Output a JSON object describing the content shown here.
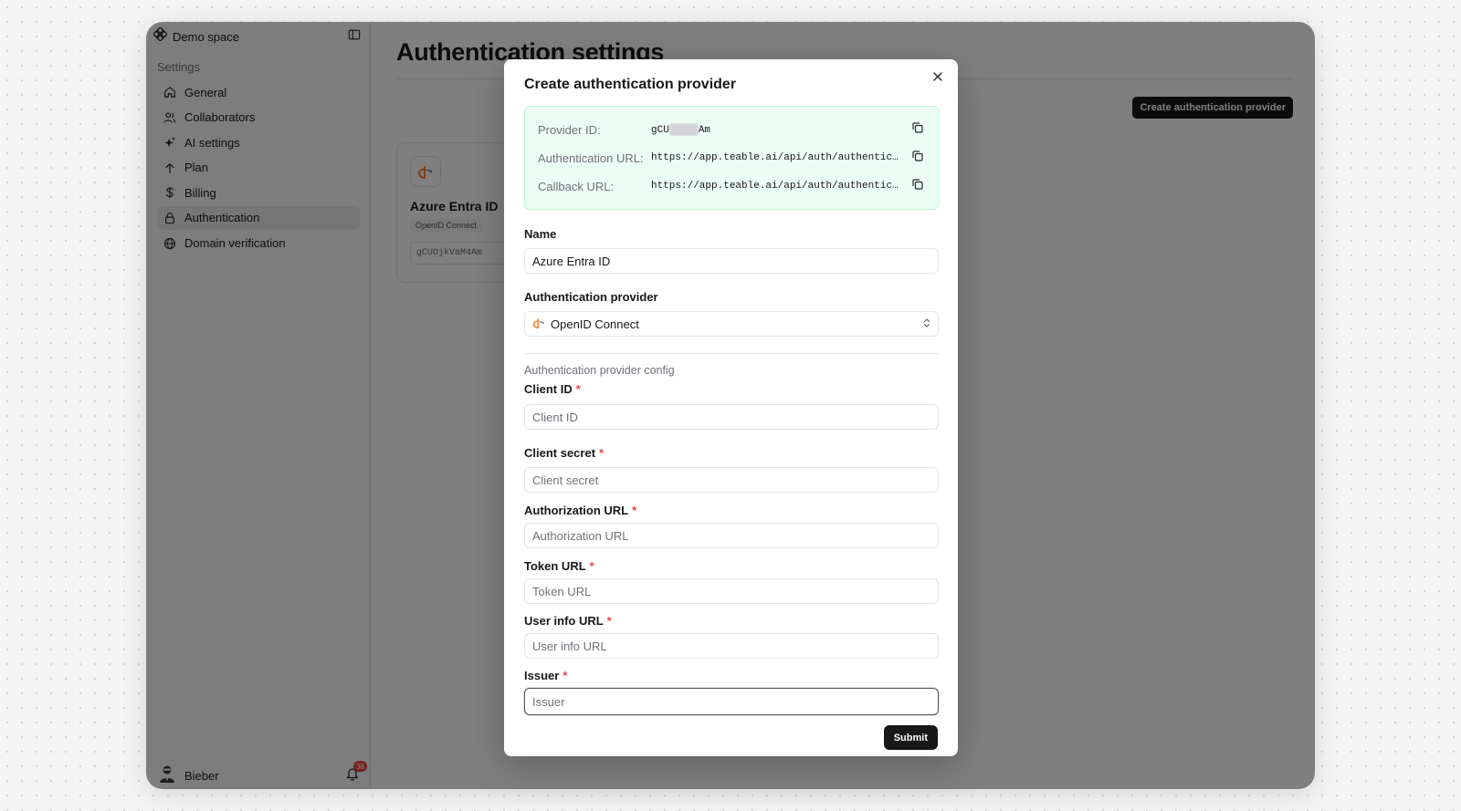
{
  "sidebar": {
    "space_name": "Demo space",
    "section_label": "Settings",
    "items": [
      {
        "label": "General",
        "icon": "home-icon"
      },
      {
        "label": "Collaborators",
        "icon": "users-icon"
      },
      {
        "label": "AI settings",
        "icon": "sparkles-icon"
      },
      {
        "label": "Plan",
        "icon": "arrow-up-icon"
      },
      {
        "label": "Billing",
        "icon": "dollar-icon"
      },
      {
        "label": "Authentication",
        "icon": "lock-icon",
        "active": true
      },
      {
        "label": "Domain verification",
        "icon": "globe-icon"
      }
    ],
    "user_name": "Bieber",
    "notification_count": "38"
  },
  "main": {
    "page_title": "Authentication settings",
    "create_button": "Create authentication provider",
    "card": {
      "name": "Azure Entra ID",
      "type": "OpenID Connect",
      "id": "gCUOjkVaM4Am"
    }
  },
  "dialog": {
    "title": "Create authentication provider",
    "provider_id_label": "Provider ID:",
    "provider_id_prefix": "gCU",
    "provider_id_suffix": "Am",
    "auth_url_label": "Authentication URL:",
    "auth_url_value": "https://app.teable.ai/api/auth/authentica…",
    "callback_url_label": "Callback URL:",
    "callback_url_value": "https://app.teable.ai/api/auth/authentica…",
    "name_label": "Name",
    "name_value": "Azure Entra ID",
    "provider_label": "Authentication provider",
    "provider_value": "OpenID Connect",
    "config_label": "Authentication provider config",
    "fields": {
      "client_id": {
        "label": "Client ID",
        "placeholder": "Client ID"
      },
      "client_secret": {
        "label": "Client secret",
        "placeholder": "Client secret"
      },
      "authorization_url": {
        "label": "Authorization URL",
        "placeholder": "Authorization URL"
      },
      "token_url": {
        "label": "Token URL",
        "placeholder": "Token URL"
      },
      "user_info_url": {
        "label": "User info URL",
        "placeholder": "User info URL"
      },
      "issuer": {
        "label": "Issuer",
        "placeholder": "Issuer"
      }
    },
    "required_mark": "*",
    "submit_label": "Submit"
  },
  "colors": {
    "accent": "#18181b",
    "info_bg": "#ecfdf5",
    "required": "#ef4444",
    "openid_orange": "#f97316"
  }
}
